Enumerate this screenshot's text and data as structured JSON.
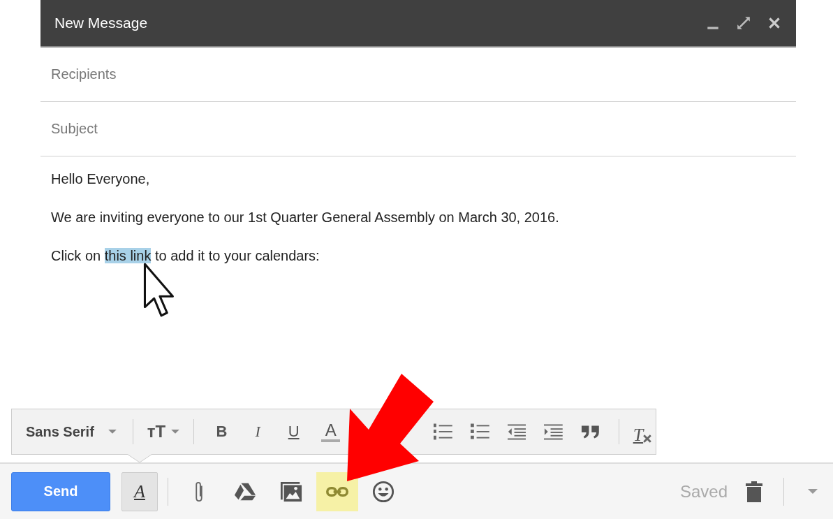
{
  "window": {
    "title": "New Message",
    "controls": [
      {
        "kind": "minimize"
      },
      {
        "kind": "expand"
      },
      {
        "kind": "close"
      }
    ]
  },
  "recipients": {
    "placeholder": "Recipients"
  },
  "subject": {
    "placeholder": "Subject"
  },
  "body": [
    {
      "text": "Hello Everyone,"
    },
    {
      "text": "We are inviting everyone to our 1st Quarter General Assembly on March 30, 2016."
    },
    {
      "text": "Click on ",
      "selected_text": "this link",
      "after": " to add it to your calendars:"
    }
  ],
  "format_toolbar": [
    {
      "kind": "font",
      "label": "Sans Serif"
    },
    {
      "kind": "separator"
    },
    {
      "kind": "size",
      "label": "ᴛT"
    },
    {
      "kind": "separator"
    },
    {
      "kind": "bold",
      "label": "B"
    },
    {
      "kind": "italic",
      "label": "I"
    },
    {
      "kind": "underline",
      "label": "U"
    },
    {
      "kind": "color",
      "label": "A"
    },
    {
      "kind": "hidden"
    },
    {
      "kind": "numbered"
    },
    {
      "kind": "bulleted"
    },
    {
      "kind": "outdent"
    },
    {
      "kind": "indent"
    },
    {
      "kind": "quote"
    },
    {
      "kind": "separator"
    },
    {
      "kind": "clear",
      "label": "T"
    }
  ],
  "bottom_bar": {
    "send": "Send",
    "tools": [
      {
        "kind": "format",
        "label": "A",
        "pressed": true,
        "highlighted": false
      },
      {
        "kind": "attach",
        "pressed": false,
        "highlighted": false
      },
      {
        "kind": "drive",
        "pressed": false,
        "highlighted": false
      },
      {
        "kind": "photo",
        "pressed": false,
        "highlighted": false
      },
      {
        "kind": "link",
        "pressed": false,
        "highlighted": true
      },
      {
        "kind": "emoji",
        "pressed": false,
        "highlighted": false
      }
    ],
    "status": "Saved"
  }
}
